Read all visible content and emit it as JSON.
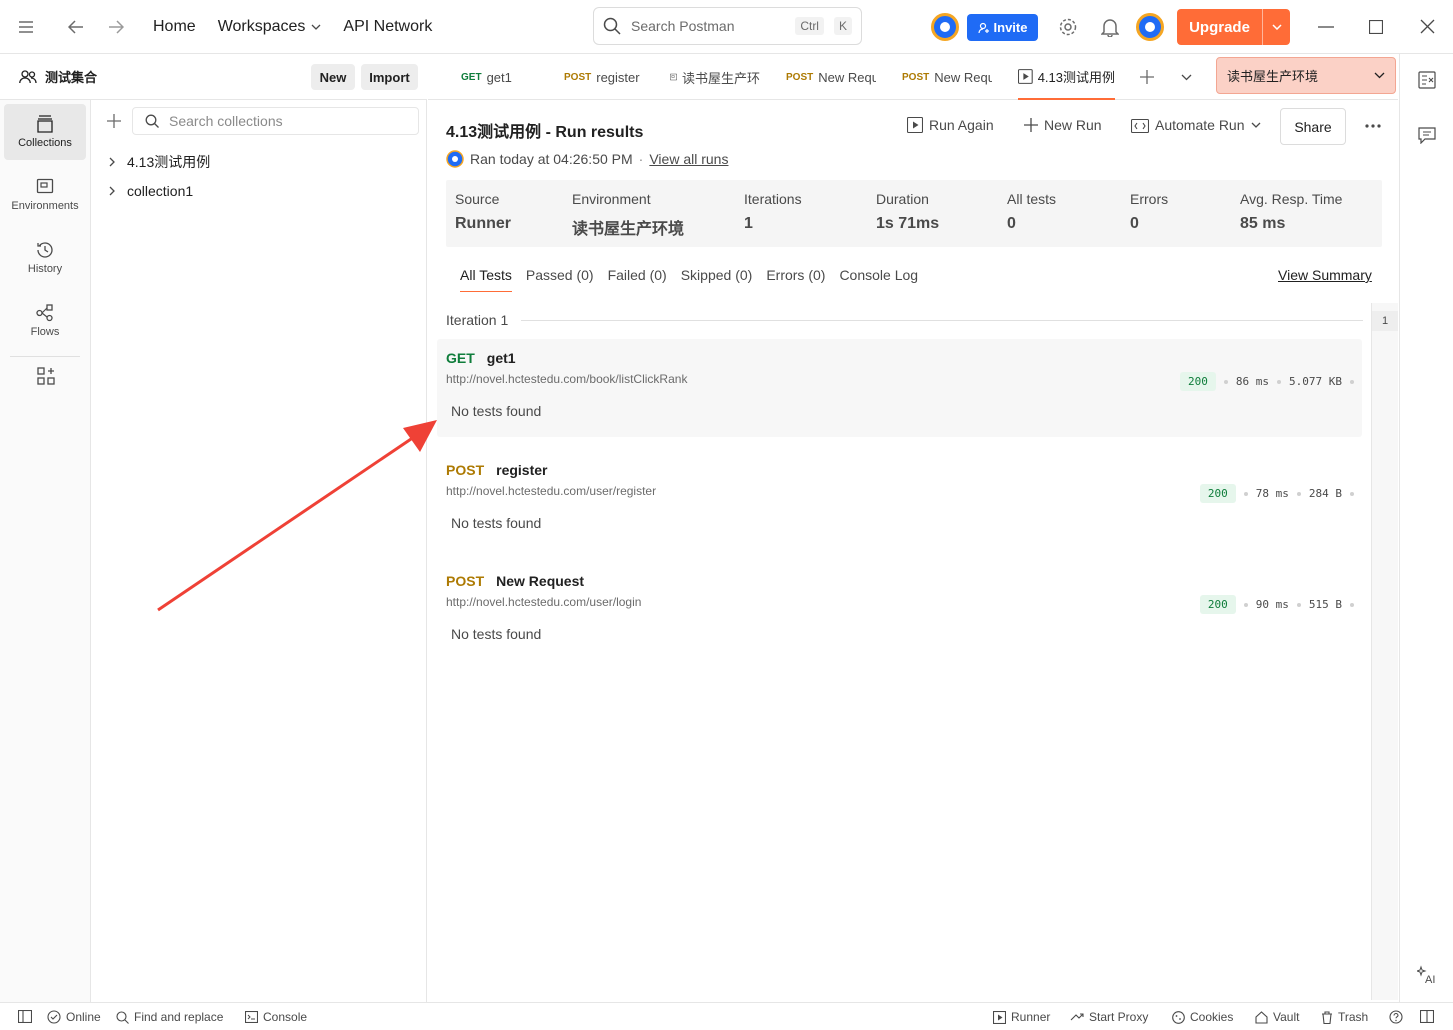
{
  "topbar": {
    "home": "Home",
    "workspaces": "Workspaces",
    "api_network": "API Network",
    "search_placeholder": "Search Postman",
    "shortcut_ctrl": "Ctrl",
    "shortcut_k": "K",
    "invite": "Invite",
    "upgrade": "Upgrade"
  },
  "workspace": {
    "name": "测试集合",
    "new_label": "New",
    "import_label": "Import"
  },
  "rail": [
    {
      "label": "Collections",
      "icon": "collections-icon"
    },
    {
      "label": "Environments",
      "icon": "environments-icon"
    },
    {
      "label": "History",
      "icon": "history-icon"
    },
    {
      "label": "Flows",
      "icon": "flows-icon"
    }
  ],
  "sidebar": {
    "search_placeholder": "Search collections",
    "collections": [
      "4.13测试用例",
      "collection1"
    ]
  },
  "tabs": [
    {
      "method": "GET",
      "name": "get1"
    },
    {
      "method": "POST",
      "name": "register"
    },
    {
      "method": "",
      "name": "读书屋生产环"
    },
    {
      "method": "POST",
      "name": "New Requ"
    },
    {
      "method": "POST",
      "name": "New Requ"
    },
    {
      "method": "",
      "name": "4.13测试用例"
    }
  ],
  "environment": "读书屋生产环境",
  "run": {
    "title": "4.13测试用例 - Run results",
    "actions": {
      "run_again": "Run Again",
      "new_run": "New Run",
      "automate_run": "Automate Run",
      "share": "Share"
    },
    "ran_at": "Ran today at 04:26:50 PM",
    "separator": "·",
    "view_all_runs": "View all runs",
    "stats": [
      {
        "key": "Source",
        "value": "Runner"
      },
      {
        "key": "Environment",
        "value": "读书屋生产环境"
      },
      {
        "key": "Iterations",
        "value": "1"
      },
      {
        "key": "Duration",
        "value": "1s 71ms"
      },
      {
        "key": "All tests",
        "value": "0"
      },
      {
        "key": "Errors",
        "value": "0"
      },
      {
        "key": "Avg. Resp. Time",
        "value": "85 ms"
      }
    ],
    "filters": [
      "All Tests",
      "Passed (0)",
      "Failed (0)",
      "Skipped (0)",
      "Errors (0)",
      "Console Log"
    ],
    "view_summary": "View Summary",
    "iteration_label": "Iteration 1",
    "iteration_number": "1",
    "requests": [
      {
        "method": "GET",
        "name": "get1",
        "url": "http://novel.hctestedu.com/book/listClickRank",
        "status": "200",
        "time": "86 ms",
        "size": "5.077 KB",
        "result": "No tests found"
      },
      {
        "method": "POST",
        "name": "register",
        "url": "http://novel.hctestedu.com/user/register",
        "status": "200",
        "time": "78 ms",
        "size": "284 B",
        "result": "No tests found"
      },
      {
        "method": "POST",
        "name": "New Request",
        "url": "http://novel.hctestedu.com/user/login",
        "status": "200",
        "time": "90 ms",
        "size": "515 B",
        "result": "No tests found"
      }
    ]
  },
  "statusbar": {
    "online": "Online",
    "find_replace": "Find and replace",
    "console": "Console",
    "runner": "Runner",
    "start_proxy": "Start Proxy",
    "cookies": "Cookies",
    "vault": "Vault",
    "trash": "Trash"
  },
  "colors": {
    "accent": "#ff6c37",
    "invite_blue": "#1f6bf5",
    "get_green": "#0f7d3b",
    "post_amber": "#ad7a03",
    "env_bg": "#fbd1c6",
    "arrow_red": "#ef4136"
  }
}
